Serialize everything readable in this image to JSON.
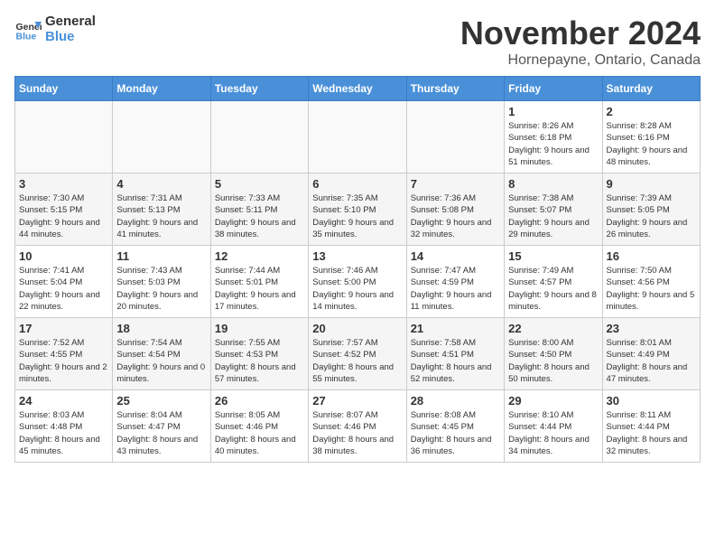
{
  "logo": {
    "line1": "General",
    "line2": "Blue"
  },
  "title": "November 2024",
  "location": "Hornepayne, Ontario, Canada",
  "weekdays": [
    "Sunday",
    "Monday",
    "Tuesday",
    "Wednesday",
    "Thursday",
    "Friday",
    "Saturday"
  ],
  "weeks": [
    [
      {
        "day": "",
        "info": ""
      },
      {
        "day": "",
        "info": ""
      },
      {
        "day": "",
        "info": ""
      },
      {
        "day": "",
        "info": ""
      },
      {
        "day": "",
        "info": ""
      },
      {
        "day": "1",
        "info": "Sunrise: 8:26 AM\nSunset: 6:18 PM\nDaylight: 9 hours and 51 minutes."
      },
      {
        "day": "2",
        "info": "Sunrise: 8:28 AM\nSunset: 6:16 PM\nDaylight: 9 hours and 48 minutes."
      }
    ],
    [
      {
        "day": "3",
        "info": "Sunrise: 7:30 AM\nSunset: 5:15 PM\nDaylight: 9 hours and 44 minutes."
      },
      {
        "day": "4",
        "info": "Sunrise: 7:31 AM\nSunset: 5:13 PM\nDaylight: 9 hours and 41 minutes."
      },
      {
        "day": "5",
        "info": "Sunrise: 7:33 AM\nSunset: 5:11 PM\nDaylight: 9 hours and 38 minutes."
      },
      {
        "day": "6",
        "info": "Sunrise: 7:35 AM\nSunset: 5:10 PM\nDaylight: 9 hours and 35 minutes."
      },
      {
        "day": "7",
        "info": "Sunrise: 7:36 AM\nSunset: 5:08 PM\nDaylight: 9 hours and 32 minutes."
      },
      {
        "day": "8",
        "info": "Sunrise: 7:38 AM\nSunset: 5:07 PM\nDaylight: 9 hours and 29 minutes."
      },
      {
        "day": "9",
        "info": "Sunrise: 7:39 AM\nSunset: 5:05 PM\nDaylight: 9 hours and 26 minutes."
      }
    ],
    [
      {
        "day": "10",
        "info": "Sunrise: 7:41 AM\nSunset: 5:04 PM\nDaylight: 9 hours and 22 minutes."
      },
      {
        "day": "11",
        "info": "Sunrise: 7:43 AM\nSunset: 5:03 PM\nDaylight: 9 hours and 20 minutes."
      },
      {
        "day": "12",
        "info": "Sunrise: 7:44 AM\nSunset: 5:01 PM\nDaylight: 9 hours and 17 minutes."
      },
      {
        "day": "13",
        "info": "Sunrise: 7:46 AM\nSunset: 5:00 PM\nDaylight: 9 hours and 14 minutes."
      },
      {
        "day": "14",
        "info": "Sunrise: 7:47 AM\nSunset: 4:59 PM\nDaylight: 9 hours and 11 minutes."
      },
      {
        "day": "15",
        "info": "Sunrise: 7:49 AM\nSunset: 4:57 PM\nDaylight: 9 hours and 8 minutes."
      },
      {
        "day": "16",
        "info": "Sunrise: 7:50 AM\nSunset: 4:56 PM\nDaylight: 9 hours and 5 minutes."
      }
    ],
    [
      {
        "day": "17",
        "info": "Sunrise: 7:52 AM\nSunset: 4:55 PM\nDaylight: 9 hours and 2 minutes."
      },
      {
        "day": "18",
        "info": "Sunrise: 7:54 AM\nSunset: 4:54 PM\nDaylight: 9 hours and 0 minutes."
      },
      {
        "day": "19",
        "info": "Sunrise: 7:55 AM\nSunset: 4:53 PM\nDaylight: 8 hours and 57 minutes."
      },
      {
        "day": "20",
        "info": "Sunrise: 7:57 AM\nSunset: 4:52 PM\nDaylight: 8 hours and 55 minutes."
      },
      {
        "day": "21",
        "info": "Sunrise: 7:58 AM\nSunset: 4:51 PM\nDaylight: 8 hours and 52 minutes."
      },
      {
        "day": "22",
        "info": "Sunrise: 8:00 AM\nSunset: 4:50 PM\nDaylight: 8 hours and 50 minutes."
      },
      {
        "day": "23",
        "info": "Sunrise: 8:01 AM\nSunset: 4:49 PM\nDaylight: 8 hours and 47 minutes."
      }
    ],
    [
      {
        "day": "24",
        "info": "Sunrise: 8:03 AM\nSunset: 4:48 PM\nDaylight: 8 hours and 45 minutes."
      },
      {
        "day": "25",
        "info": "Sunrise: 8:04 AM\nSunset: 4:47 PM\nDaylight: 8 hours and 43 minutes."
      },
      {
        "day": "26",
        "info": "Sunrise: 8:05 AM\nSunset: 4:46 PM\nDaylight: 8 hours and 40 minutes."
      },
      {
        "day": "27",
        "info": "Sunrise: 8:07 AM\nSunset: 4:46 PM\nDaylight: 8 hours and 38 minutes."
      },
      {
        "day": "28",
        "info": "Sunrise: 8:08 AM\nSunset: 4:45 PM\nDaylight: 8 hours and 36 minutes."
      },
      {
        "day": "29",
        "info": "Sunrise: 8:10 AM\nSunset: 4:44 PM\nDaylight: 8 hours and 34 minutes."
      },
      {
        "day": "30",
        "info": "Sunrise: 8:11 AM\nSunset: 4:44 PM\nDaylight: 8 hours and 32 minutes."
      }
    ]
  ]
}
